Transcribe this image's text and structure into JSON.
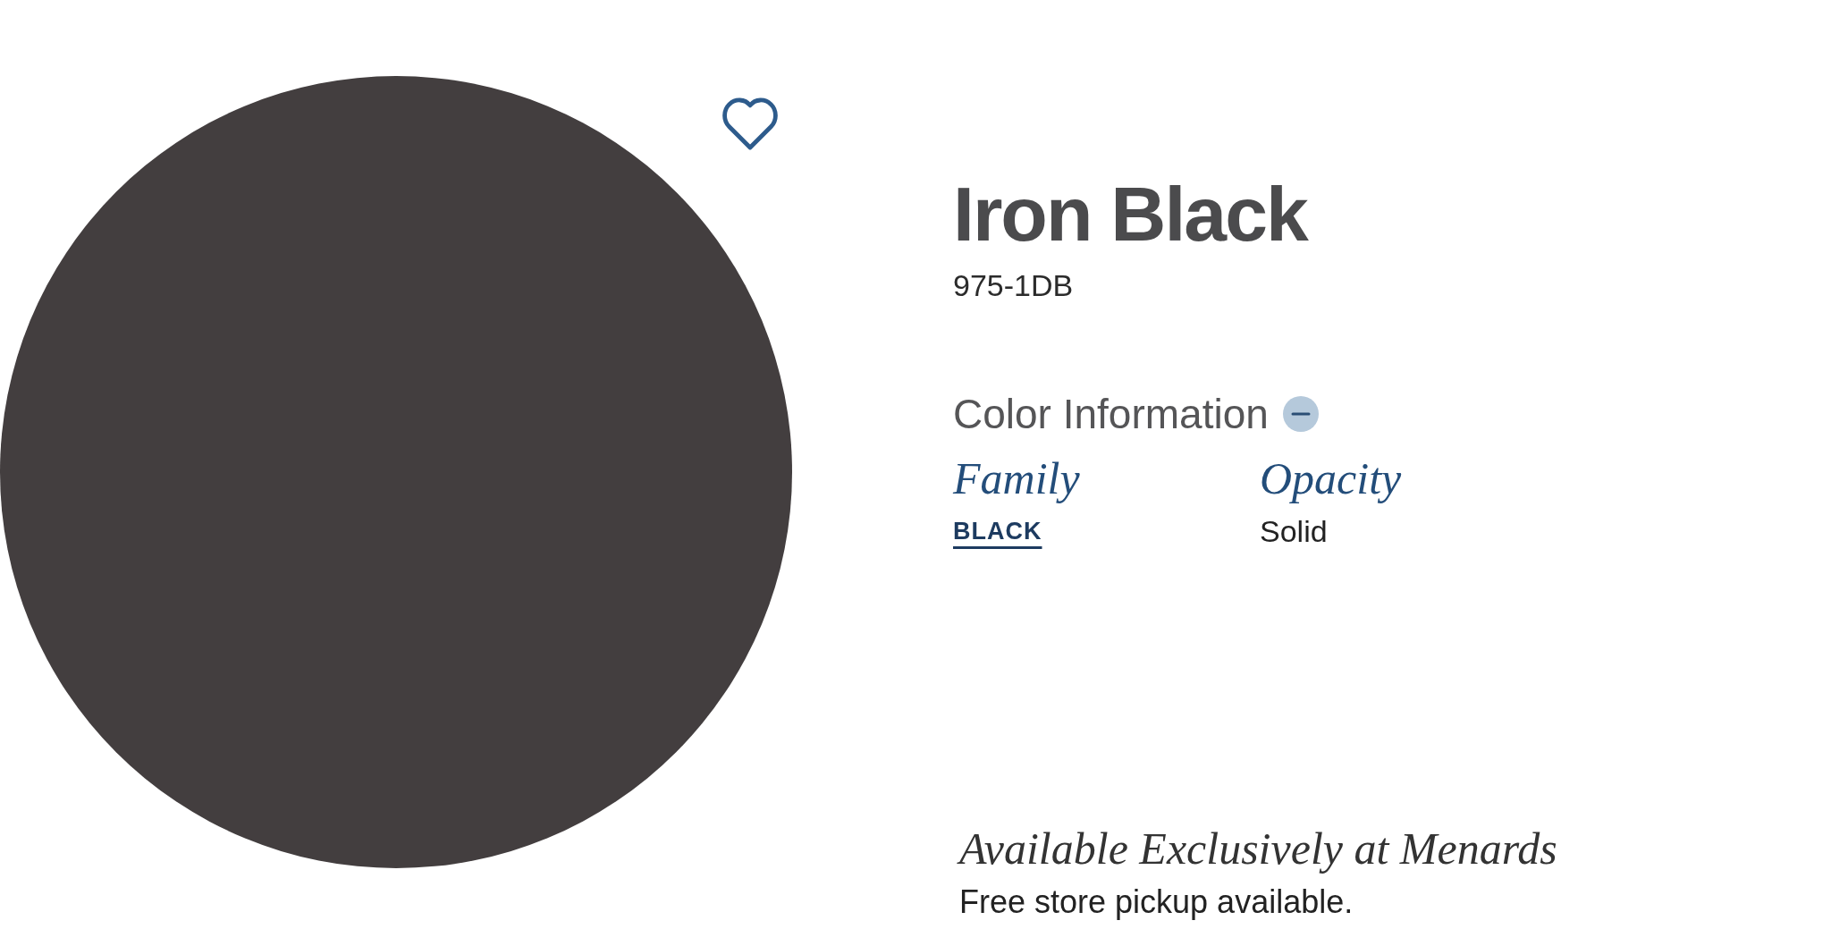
{
  "favorite_button": {
    "on": false
  },
  "product": {
    "name": "Iron Black",
    "code": "975-1DB"
  },
  "color_information": {
    "heading": "Color Information",
    "expanded": true,
    "fields": [
      {
        "label": "Family",
        "value": "BLACK",
        "kind": "link"
      },
      {
        "label": "Opacity",
        "value": "Solid",
        "kind": "text"
      }
    ]
  },
  "availability": {
    "heading": "Available Exclusively at Menards",
    "note": "Free store pickup available."
  }
}
